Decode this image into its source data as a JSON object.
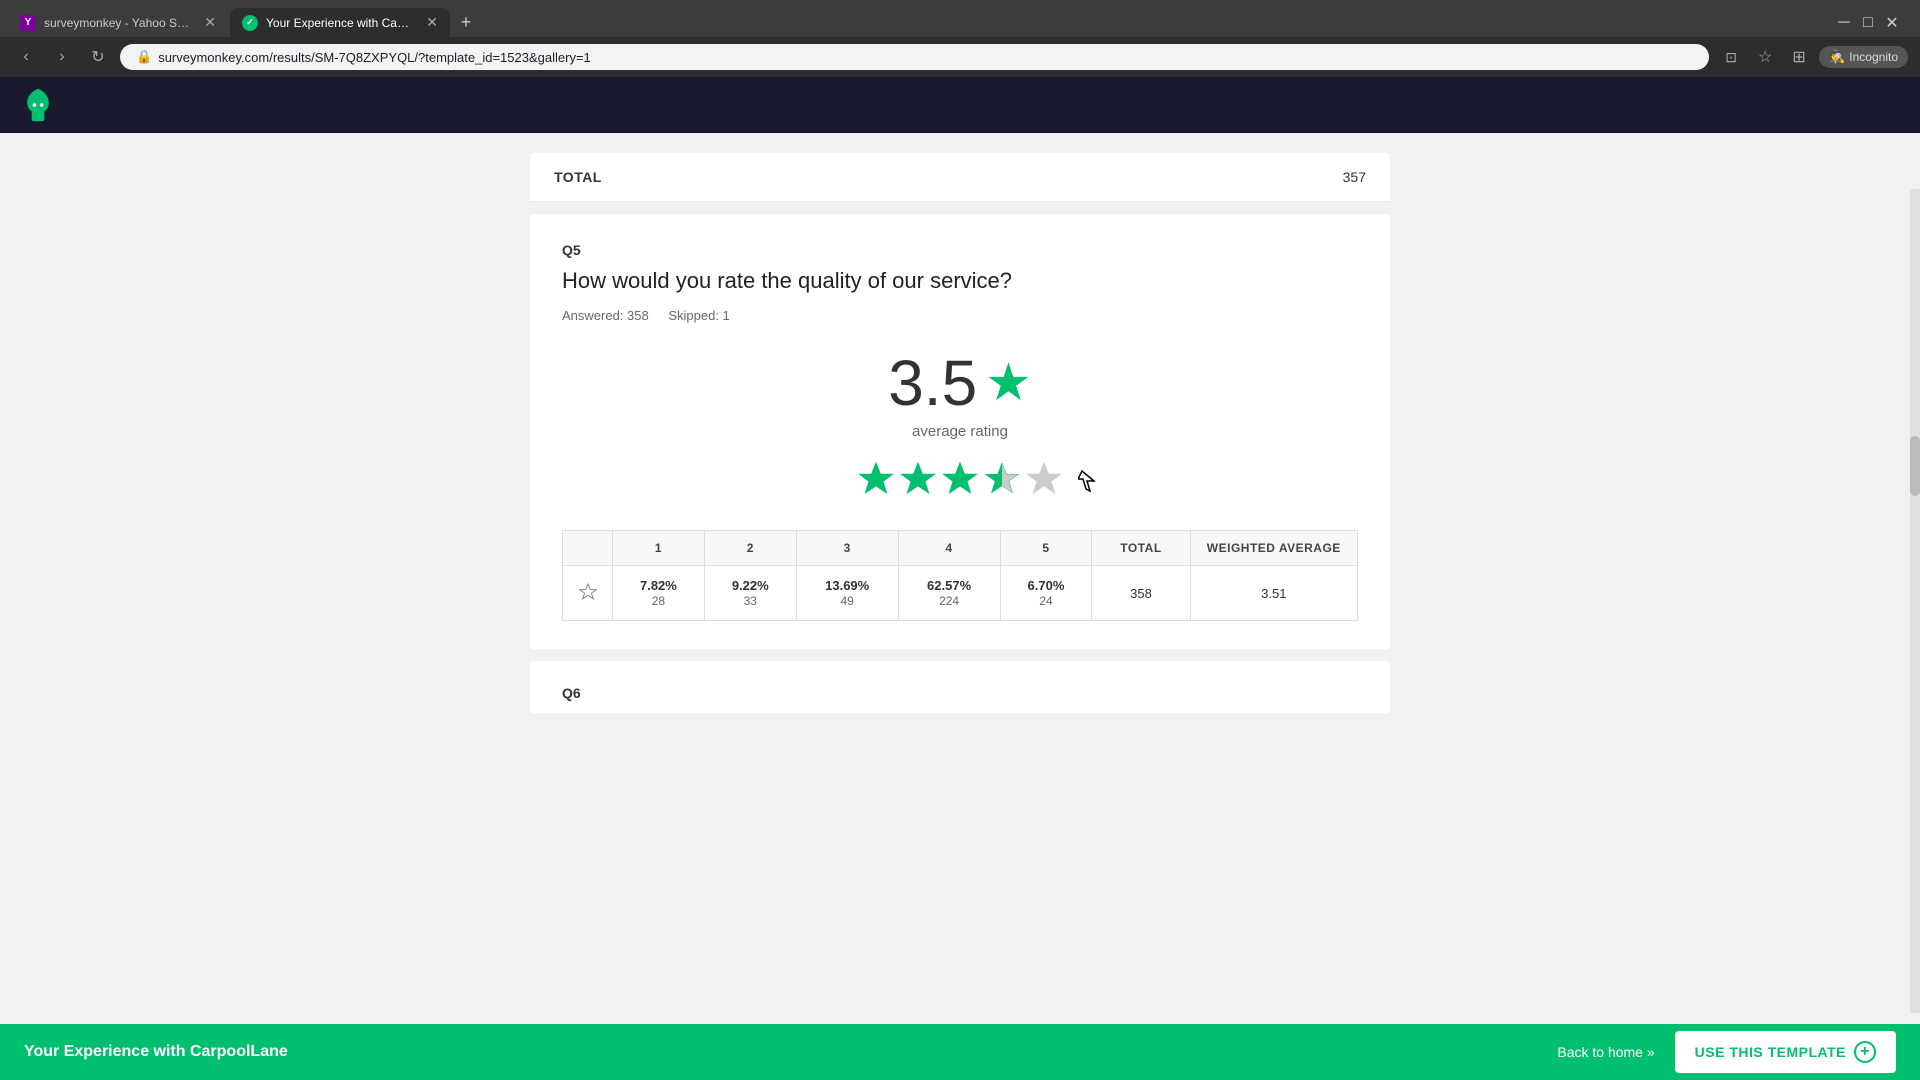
{
  "browser": {
    "tabs": [
      {
        "id": "tab1",
        "label": "surveymonkey - Yahoo Search ...",
        "active": false,
        "favicon_type": "yahoo"
      },
      {
        "id": "tab2",
        "label": "Your Experience with Carpool...",
        "active": true,
        "favicon_type": "surveymonkey"
      }
    ],
    "new_tab_label": "+",
    "address_url": "surveymonkey.com/results/SM-7Q8ZXPYQL/?template_id=1523&gallery=1",
    "incognito_label": "Incognito"
  },
  "header": {
    "logo_label": "SM"
  },
  "partial_top": {
    "label": "TOTAL",
    "value": "357"
  },
  "q5": {
    "number": "Q5",
    "question": "How would you rate the quality of our service?",
    "answered_label": "Answered: 358",
    "skipped_label": "Skipped: 1",
    "average_rating": "3.5",
    "average_label": "average rating",
    "stars": [
      {
        "filled": true
      },
      {
        "filled": true
      },
      {
        "filled": true
      },
      {
        "half": true
      },
      {
        "filled": false
      }
    ],
    "table": {
      "headers": [
        "",
        "1",
        "2",
        "3",
        "4",
        "5",
        "TOTAL",
        "WEIGHTED AVERAGE"
      ],
      "row": {
        "col1_pct": "7.82%",
        "col1_cnt": "28",
        "col2_pct": "9.22%",
        "col2_cnt": "33",
        "col3_pct": "13.69%",
        "col3_cnt": "49",
        "col4_pct": "62.57%",
        "col4_cnt": "224",
        "col5_pct": "6.70%",
        "col5_cnt": "24",
        "total": "358",
        "weighted_avg": "3.51"
      }
    }
  },
  "q6": {
    "number": "Q6"
  },
  "bottom_bar": {
    "title": "Your Experience with CarpoolLane",
    "back_home_label": "Back to home »",
    "use_template_label": "USE THIS TEMPLATE",
    "use_template_icon": "+"
  }
}
